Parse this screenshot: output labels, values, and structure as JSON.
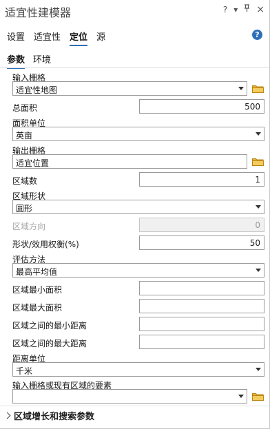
{
  "window": {
    "title": "适宜性建模器",
    "controls": {
      "help": "?",
      "menu": "▾",
      "pin": "ᛘ",
      "close": "×"
    }
  },
  "tabs": [
    {
      "label": "设置"
    },
    {
      "label": "适宜性"
    },
    {
      "label": "定位",
      "active": true
    },
    {
      "label": "源"
    }
  ],
  "help_icon": "?",
  "subtabs": [
    {
      "label": "参数",
      "active": true
    },
    {
      "label": "环境"
    }
  ],
  "params": {
    "input_raster": {
      "label": "输入栅格",
      "value": "适宜性地图"
    },
    "total_area": {
      "label": "总面积",
      "value": "500"
    },
    "area_unit": {
      "label": "面积单位",
      "value": "英亩"
    },
    "output_raster": {
      "label": "输出栅格",
      "value": "适宜位置"
    },
    "region_count": {
      "label": "区域数",
      "value": "1"
    },
    "region_shape": {
      "label": "区域形状",
      "value": "圆形"
    },
    "region_direction": {
      "label": "区域方向",
      "value": "0"
    },
    "shape_utility": {
      "label": "形状/效用权衡(%)",
      "value": "50"
    },
    "evaluation_method": {
      "label": "评估方法",
      "value": "最高平均值"
    },
    "min_area": {
      "label": "区域最小面积",
      "value": ""
    },
    "max_area": {
      "label": "区域最大面积",
      "value": ""
    },
    "min_distance": {
      "label": "区域之间的最小距离",
      "value": ""
    },
    "max_distance": {
      "label": "区域之间的最大距离",
      "value": ""
    },
    "distance_unit": {
      "label": "距离单位",
      "value": "千米"
    },
    "existing_regions": {
      "label": "输入栅格或现有区域的要素",
      "value": ""
    }
  },
  "expander": {
    "label": "区域增长和搜索参数"
  },
  "colors": {
    "accent": "#2f6fb8",
    "folder": "#e8b23a"
  }
}
